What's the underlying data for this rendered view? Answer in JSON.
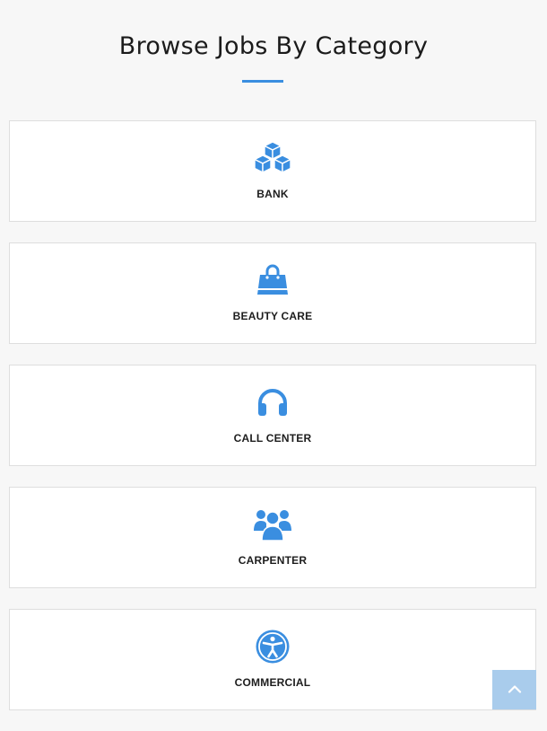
{
  "page": {
    "title": "Browse Jobs By Category",
    "accent_color": "#3a8ee0"
  },
  "categories": [
    {
      "label": "BANK",
      "icon": "cubes-icon"
    },
    {
      "label": "BEAUTY CARE",
      "icon": "shopping-bag-icon"
    },
    {
      "label": "CALL CENTER",
      "icon": "headphones-icon"
    },
    {
      "label": "CARPENTER",
      "icon": "users-icon"
    },
    {
      "label": "COMMERCIAL",
      "icon": "universal-access-icon"
    }
  ],
  "back_to_top": {
    "icon": "chevron-up-icon"
  }
}
